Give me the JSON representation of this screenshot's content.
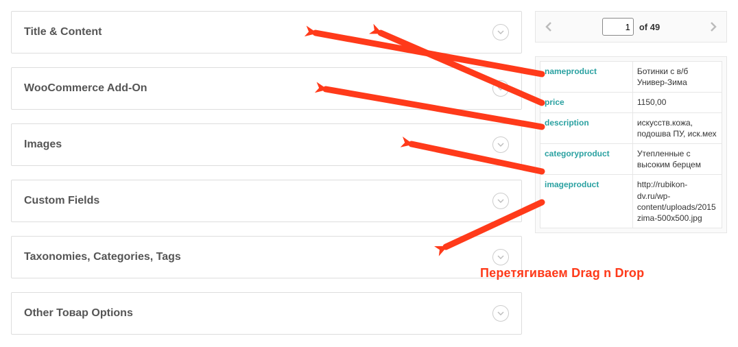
{
  "panels": [
    {
      "title": "Title & Content"
    },
    {
      "title": "WooCommerce Add-On"
    },
    {
      "title": "Images"
    },
    {
      "title": "Custom Fields"
    },
    {
      "title": "Taxonomies, Categories, Tags"
    },
    {
      "title": "Other Товар Options"
    }
  ],
  "pager": {
    "current": "1",
    "of_label": "of 49"
  },
  "fields": [
    {
      "key": "nameproduct",
      "value": "Ботинки с в/б Универ-Зима"
    },
    {
      "key": "price",
      "value": "1150,00"
    },
    {
      "key": "description",
      "value": "искусств.кожа, подошва ПУ, иск.мех"
    },
    {
      "key": "categoryproduct",
      "value": "Утепленные с высоким берцем"
    },
    {
      "key": "imageproduct",
      "value": "http://rubikon-dv.ru/wp-content/uploads/2015zima-500x500.jpg"
    }
  ],
  "annotation": "Перетягиваем Drag n Drop"
}
